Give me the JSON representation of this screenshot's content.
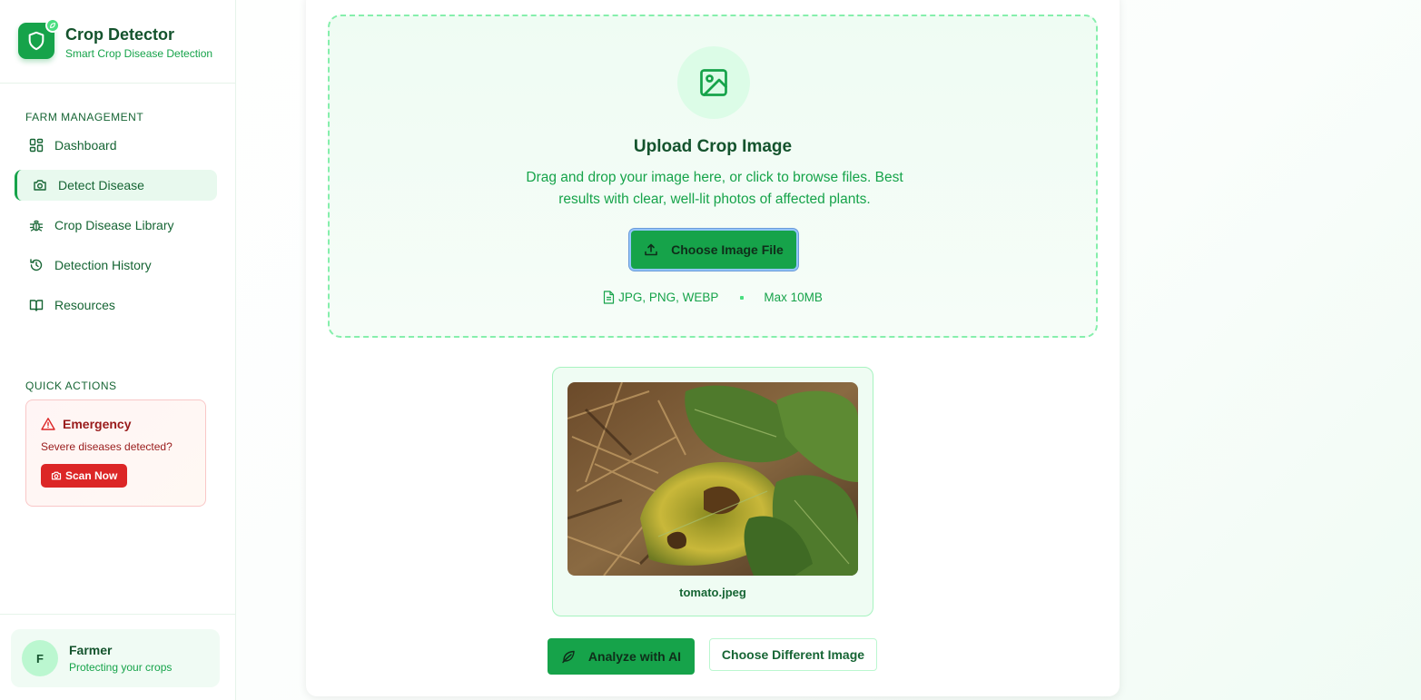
{
  "brand": {
    "title": "Crop Detector",
    "subtitle": "Smart Crop Disease Detection"
  },
  "sidebar": {
    "section_farm": "FARM MANAGEMENT",
    "items": [
      {
        "label": "Dashboard",
        "icon": "dashboard-icon",
        "active": false
      },
      {
        "label": "Detect Disease",
        "icon": "camera-icon",
        "active": true
      },
      {
        "label": "Crop Disease Library",
        "icon": "bug-icon",
        "active": false
      },
      {
        "label": "Detection History",
        "icon": "history-icon",
        "active": false
      },
      {
        "label": "Resources",
        "icon": "book-icon",
        "active": false
      }
    ],
    "section_quick": "QUICK ACTIONS",
    "emergency": {
      "title": "Emergency",
      "text": "Severe diseases detected?",
      "button": "Scan Now"
    },
    "user": {
      "initial": "F",
      "name": "Farmer",
      "subtitle": "Protecting your crops"
    }
  },
  "upload": {
    "title": "Upload Crop Image",
    "description": "Drag and drop your image here, or click to browse files. Best results with clear, well-lit photos of affected plants.",
    "button": "Choose Image File",
    "formats": "JPG, PNG, WEBP",
    "max_size": "Max 10MB"
  },
  "preview": {
    "filename": "tomato.jpeg"
  },
  "actions": {
    "analyze": "Analyze with AI",
    "choose_different": "Choose Different Image"
  },
  "colors": {
    "primary": "#16a34a",
    "primary_dark": "#14532d",
    "danger": "#dc2626",
    "light_green": "#dcfce7"
  }
}
